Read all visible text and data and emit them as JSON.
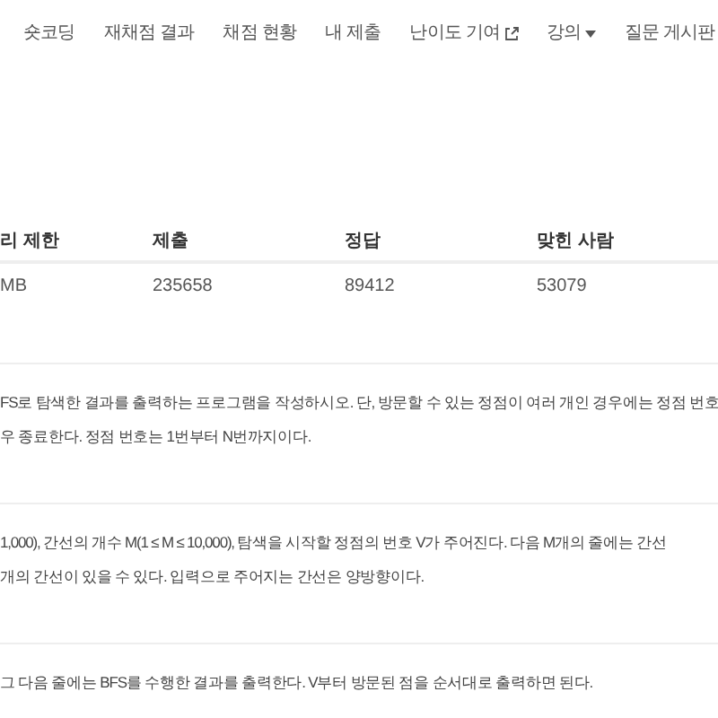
{
  "nav": [
    {
      "label": "숏코딩",
      "kind": "plain"
    },
    {
      "label": "재채점 결과",
      "kind": "plain"
    },
    {
      "label": "채점 현황",
      "kind": "plain"
    },
    {
      "label": "내 제출",
      "kind": "plain"
    },
    {
      "label": "난이도 기여",
      "kind": "external"
    },
    {
      "label": "강의",
      "kind": "dropdown"
    },
    {
      "label": "질문 게시판",
      "kind": "plain"
    }
  ],
  "table": {
    "columns": [
      "리 제한",
      "제출",
      "정답",
      "맞힌 사람"
    ],
    "rows": [
      [
        "MB",
        "235658",
        "89412",
        "53079"
      ]
    ]
  },
  "sections": [
    {
      "lines": [
        "FS로 탐색한 결과를 출력하는 프로그램을 작성하시오. 단, 방문할 수 있는 정점이 여러 개인 경우에는 정점 번호",
        "우 종료한다. 정점 번호는 1번부터 N번까지이다."
      ]
    },
    {
      "lines": [
        "1,000), 간선의 개수 M(1 ≤ M ≤ 10,000), 탐색을 시작할 정점의 번호 V가 주어진다. 다음 M개의 줄에는 간선",
        "개의 간선이 있을 수 있다. 입력으로 주어지는 간선은 양방향이다."
      ]
    },
    {
      "lines": [
        "그 다음 줄에는 BFS를 수행한 결과를 출력한다. V부터 방문된 점을 순서대로 출력하면 된다."
      ]
    }
  ]
}
